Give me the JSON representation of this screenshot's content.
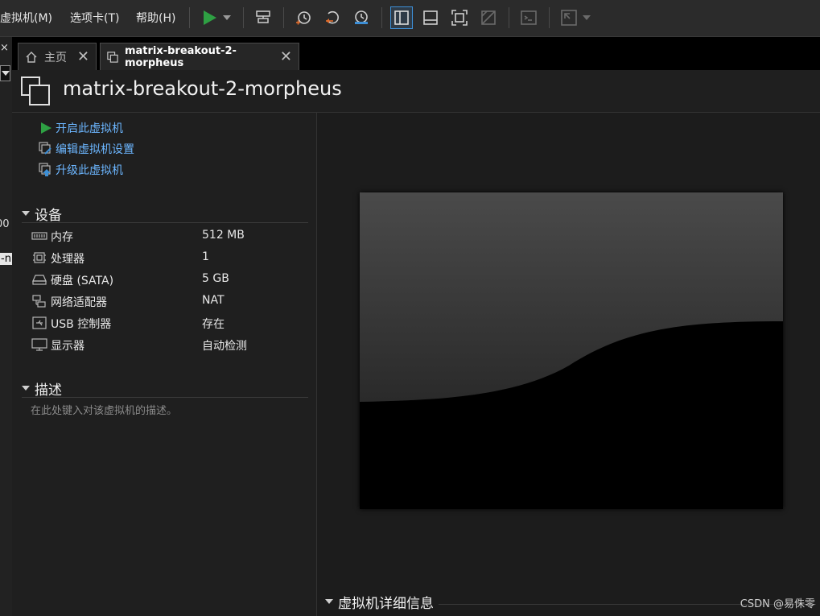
{
  "menubar": {
    "items": [
      "虚拟机(M)",
      "选项卡(T)",
      "帮助(H)"
    ]
  },
  "toolbar": {
    "buttons": [
      "play-icon",
      "dropdown-arrow-icon",
      "send-ctrl-alt-del-icon",
      "snapshot-icon",
      "revert-snapshot-icon",
      "snapshot-manager-icon",
      "show-library-icon",
      "thumbnail-bar-icon",
      "full-screen-icon",
      "unity-icon",
      "console-view-icon",
      "stretch-guest-icon",
      "stretch-dropdown-icon"
    ],
    "colors": {
      "play": "#2ea043",
      "accent": "#3d8fd6",
      "snapshot_orange": "#e06c2c"
    }
  },
  "left_strip": {
    "fragments": [
      "×",
      "00",
      "-n"
    ]
  },
  "tabs": [
    {
      "label": "主页",
      "icon": "home-icon",
      "active": false
    },
    {
      "label": "matrix-breakout-2-morpheus",
      "icon": "vm-icon",
      "active": true
    }
  ],
  "vm": {
    "title": "matrix-breakout-2-morpheus",
    "actions": [
      {
        "label": "开启此虚拟机",
        "icon": "power-on-icon"
      },
      {
        "label": "编辑虚拟机设置",
        "icon": "edit-settings-icon"
      },
      {
        "label": "升级此虚拟机",
        "icon": "upgrade-icon"
      }
    ],
    "devices_header": "设备",
    "devices": [
      {
        "name": "内存",
        "value": "512 MB",
        "icon": "memory-icon"
      },
      {
        "name": "处理器",
        "value": "1",
        "icon": "processor-icon"
      },
      {
        "name": "硬盘 (SATA)",
        "value": "5 GB",
        "icon": "hard-disk-icon"
      },
      {
        "name": "网络适配器",
        "value": "NAT",
        "icon": "network-adapter-icon"
      },
      {
        "name": "USB 控制器",
        "value": "存在",
        "icon": "usb-icon"
      },
      {
        "name": "显示器",
        "value": "自动检测",
        "icon": "display-icon"
      }
    ],
    "description_header": "描述",
    "description_placeholder": "在此处键入对该虚拟机的描述。",
    "details_header": "虚拟机详细信息"
  },
  "watermark": "CSDN @易侏零"
}
